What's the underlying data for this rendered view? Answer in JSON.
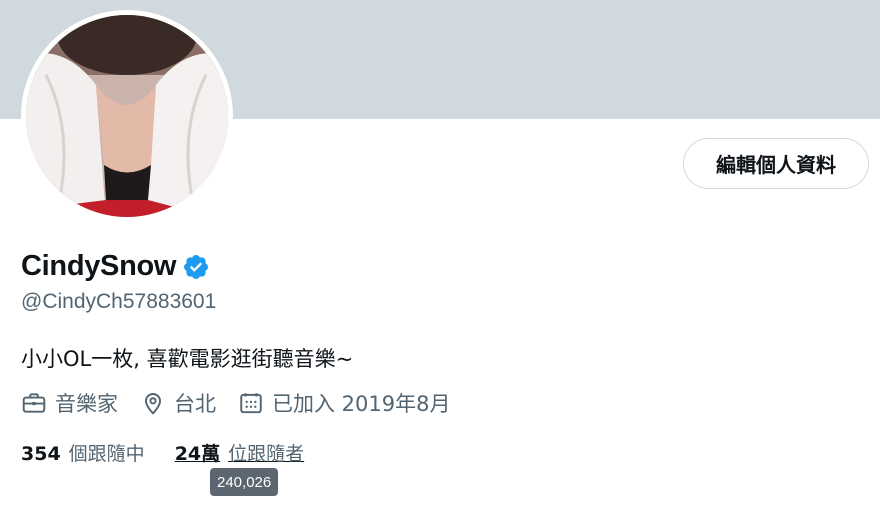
{
  "profile": {
    "display_name": "CindySnow",
    "handle": "@CindyCh57883601",
    "bio": "小小OL一枚, 喜歡電影逛街聽音樂~",
    "verified": true
  },
  "actions": {
    "edit_profile_label": "編輯個人資料"
  },
  "meta": {
    "profession": "音樂家",
    "location": "台北",
    "joined": "已加入 2019年8月"
  },
  "stats": {
    "following_count": "354",
    "following_label": "個跟隨中",
    "followers_count": "24萬",
    "followers_label": "位跟隨者"
  },
  "tooltip": {
    "text": "240,026"
  },
  "colors": {
    "banner": "#cfd9de",
    "verified_badge": "#1d9bf0",
    "secondary_text": "#536471"
  },
  "icons": [
    "verified-badge-icon",
    "briefcase-icon",
    "location-pin-icon",
    "calendar-icon"
  ]
}
